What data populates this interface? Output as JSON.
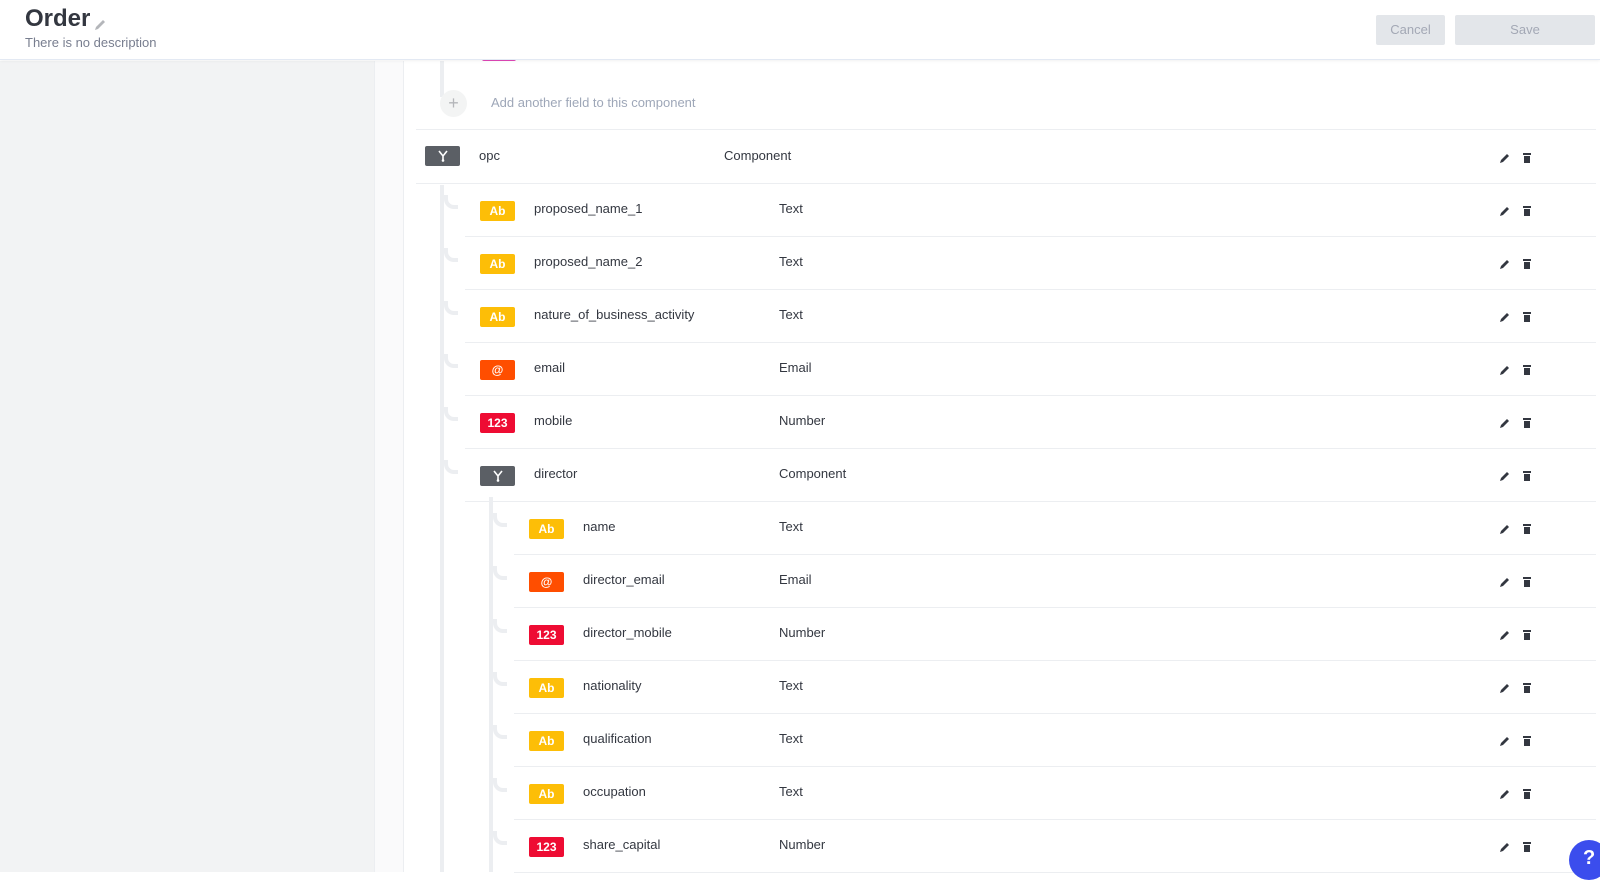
{
  "header": {
    "title": "Order",
    "subtitle": "There is no description",
    "cancel_label": "Cancel",
    "save_label": "Save"
  },
  "add_field_label": "Add another field to this component",
  "add_icon": "+",
  "help_label": "?",
  "badges": {
    "text": "Ab",
    "email": "@",
    "number": "123"
  },
  "colors": {
    "text": "#fdbe07",
    "email": "#ff4e00",
    "number": "#ee0c33",
    "component": "#5b5f65",
    "accent": "#3b4ded"
  },
  "opc": {
    "name": "opc",
    "type": "Component"
  },
  "opc_fields": [
    {
      "name": "proposed_name_1",
      "type": "Text",
      "kind": "text"
    },
    {
      "name": "proposed_name_2",
      "type": "Text",
      "kind": "text"
    },
    {
      "name": "nature_of_business_activity",
      "type": "Text",
      "kind": "text"
    },
    {
      "name": "email",
      "type": "Email",
      "kind": "email"
    },
    {
      "name": "mobile",
      "type": "Number",
      "kind": "number"
    },
    {
      "name": "director",
      "type": "Component",
      "kind": "component"
    }
  ],
  "director_fields": [
    {
      "name": "name",
      "type": "Text",
      "kind": "text"
    },
    {
      "name": "director_email",
      "type": "Email",
      "kind": "email"
    },
    {
      "name": "director_mobile",
      "type": "Number",
      "kind": "number"
    },
    {
      "name": "nationality",
      "type": "Text",
      "kind": "text"
    },
    {
      "name": "qualification",
      "type": "Text",
      "kind": "text"
    },
    {
      "name": "occupation",
      "type": "Text",
      "kind": "text"
    },
    {
      "name": "share_capital",
      "type": "Number",
      "kind": "number"
    }
  ]
}
